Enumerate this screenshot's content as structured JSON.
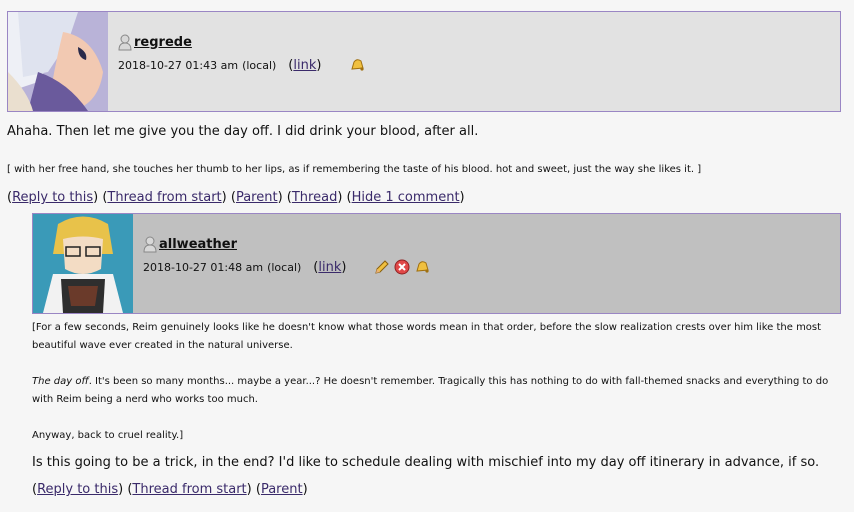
{
  "comment1": {
    "username": "regrede",
    "date": "2018-10-27 01:43 am",
    "local": "(local)",
    "link_label": "link",
    "text": "Ahaha. Then let me give you the day off. I did drink your blood, after all.",
    "action": "[ with her free hand, she touches her thumb to her lips, as if remembering the taste of his blood. hot and sweet, just the way she likes it. ]",
    "links": [
      "Reply to this",
      "Thread from start",
      "Parent",
      "Thread",
      "Hide 1 comment"
    ]
  },
  "comment2": {
    "username": "allweather",
    "date": "2018-10-27 01:48 am",
    "local": "(local)",
    "link_label": "link",
    "rp1": "[For a few seconds, Reim genuinely looks like he doesn't know what those words mean in that order, before the slow realization crests over him like the most beautiful wave ever created in the natural universe.",
    "rp2_em": "The day off",
    "rp2_rest": ". It's been so many months... maybe a year...? He doesn't remember. Tragically this has nothing to do with fall-themed snacks and everything to do with Reim being a nerd who works too much.",
    "rp3": "Anyway, back to cruel reality.]",
    "text": "Is this going to be a trick, in the end? I'd like to schedule dealing with mischief into my day off itinerary in advance, if so.",
    "links": [
      "Reply to this",
      "Thread from start",
      "Parent"
    ]
  }
}
